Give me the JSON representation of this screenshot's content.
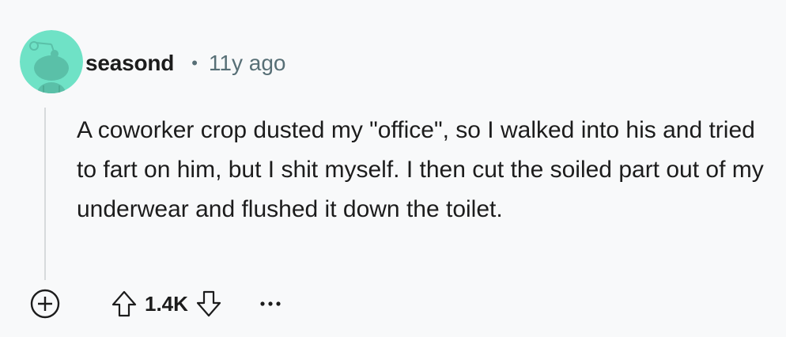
{
  "comment": {
    "username": "seasond",
    "separator": "•",
    "timestamp": "11y ago",
    "body": "A coworker crop dusted my \"office\", so I walked into his and tried to fart on him, but I shit myself. I then cut the soiled part out of my underwear and flushed it down the toilet.",
    "score": "1.4K"
  },
  "icons": {
    "avatar": "snoo-avatar-icon",
    "expand": "plus-circle-icon",
    "upvote": "arrow-up-icon",
    "downvote": "arrow-down-icon",
    "more": "ellipsis-icon"
  },
  "colors": {
    "background": "#f8f9fa",
    "avatar_background": "#6fe2c6",
    "meta_text": "#576f76",
    "thread_line": "#d7dadc"
  }
}
